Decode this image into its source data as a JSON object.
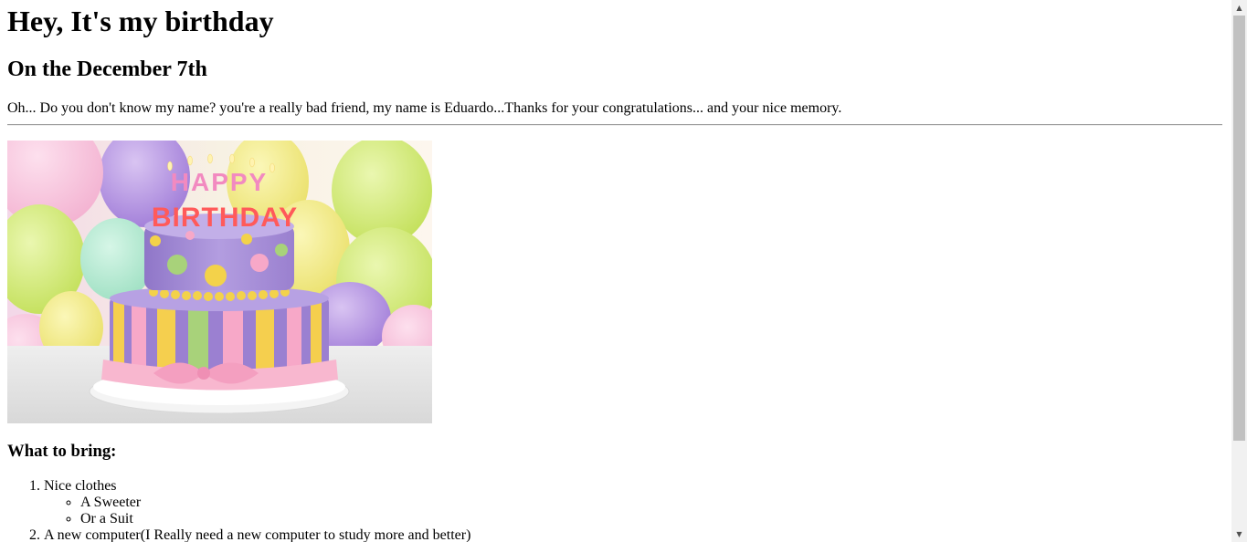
{
  "page": {
    "heading": "Hey, It's my birthday",
    "subheading": "On the December 7th",
    "message": "Oh... Do you don't know my name? you're a really bad friend, my name is Eduardo...Thanks for your congratulations... and your nice memory.",
    "image": {
      "topper_line1": "HAPPY",
      "topper_line2": "BIRTHDAY"
    },
    "bring_heading": "What to bring:",
    "bring_list": [
      {
        "label": "Nice clothes",
        "sub": [
          "A Sweeter",
          "Or a Suit"
        ]
      },
      {
        "label": "A new computer(I Really need a new computer to study more and better)"
      }
    ]
  },
  "scrollbar": {
    "up_icon": "triangle-up-icon",
    "down_icon": "triangle-down-icon"
  },
  "colors": {
    "cake_top": "#a58ed6",
    "cake_bottom_purple": "#9a7fd0",
    "stripe_yellow": "#f4d04a",
    "stripe_green": "#a8d27a",
    "stripe_pink": "#f7a8c8",
    "ribbon_pink": "#f8b7cf"
  }
}
